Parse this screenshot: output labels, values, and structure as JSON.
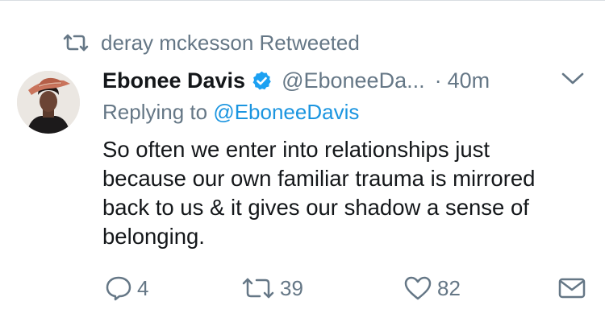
{
  "retweet_context": {
    "text": "deray mckesson Retweeted",
    "icon": "retweet-icon"
  },
  "tweet": {
    "display_name": "Ebonee Davis",
    "verified": true,
    "handle": "@EboneeDa...",
    "separator": "·",
    "time": "40m",
    "replying_prefix": "Replying to ",
    "replying_to": "@EboneeDavis",
    "text_lines": [
      "So often we enter into relationships just",
      "because our own familiar trauma is mirrored",
      "back to us & it gives our shadow a sense of",
      "belonging."
    ]
  },
  "actions": {
    "reply_count": "4",
    "retweet_count": "39",
    "like_count": "82"
  },
  "colors": {
    "text": "#14171a",
    "secondary": "#657786",
    "link": "#1b95e0",
    "verified": "#1da1f2"
  }
}
